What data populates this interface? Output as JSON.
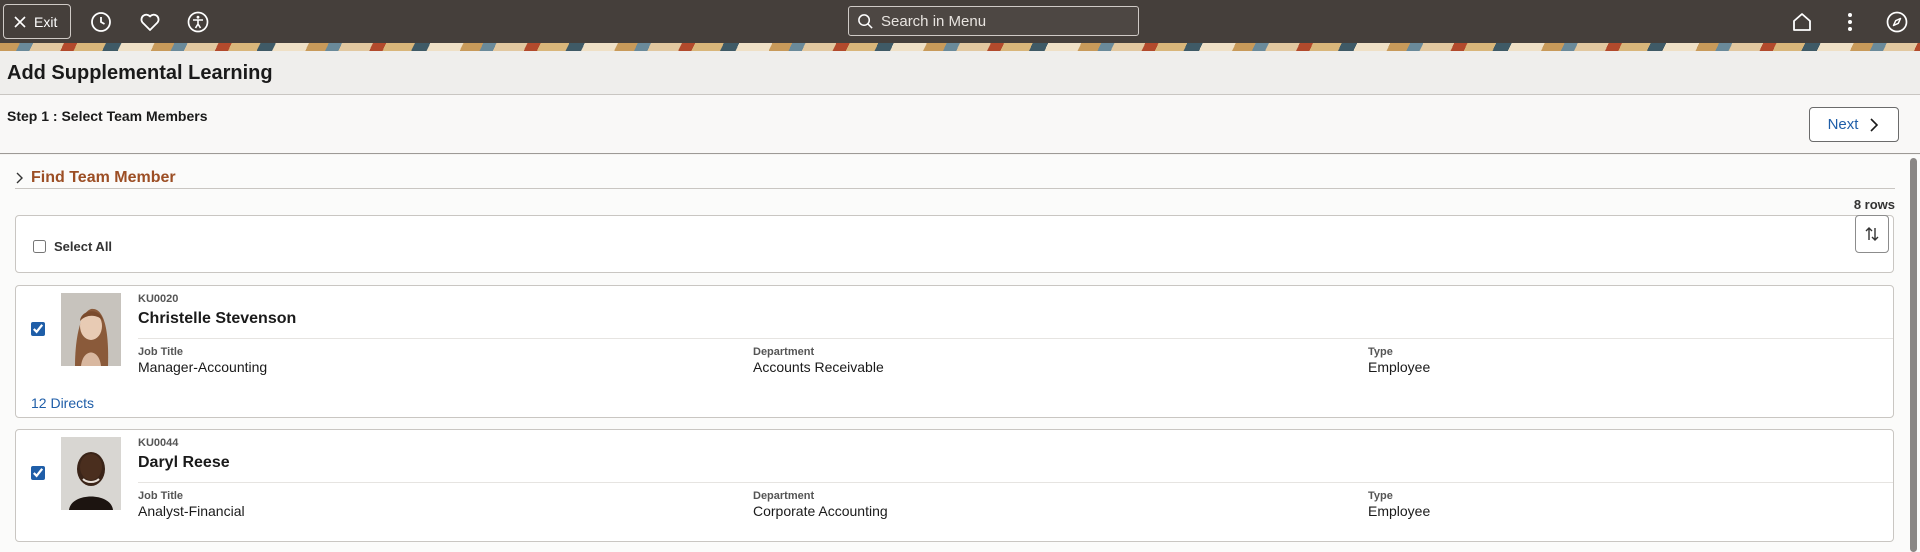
{
  "header": {
    "exit_label": "Exit",
    "search_placeholder": "Search in Menu",
    "icons": [
      "close-icon",
      "history-icon",
      "heart-icon",
      "accessibility-icon",
      "search-icon",
      "home-icon",
      "more-vertical-icon",
      "compass-icon"
    ]
  },
  "page": {
    "title": "Add Supplemental Learning",
    "step_label": "Step 1 : Select Team Members",
    "next_label": "Next"
  },
  "find": {
    "label": "Find Team Member"
  },
  "list": {
    "rows_count": "8 rows",
    "select_all_label": "Select All",
    "select_all_checked": false,
    "employees": [
      {
        "id": "KU0020",
        "name": "Christelle Stevenson",
        "checked": true,
        "job_title_label": "Job Title",
        "job_title": "Manager-Accounting",
        "department_label": "Department",
        "department": "Accounts Receivable",
        "type_label": "Type",
        "type": "Employee",
        "directs": "12 Directs"
      },
      {
        "id": "KU0044",
        "name": "Daryl Reese",
        "checked": true,
        "job_title_label": "Job Title",
        "job_title": "Analyst-Financial",
        "department_label": "Department",
        "department": "Corporate Accounting",
        "type_label": "Type",
        "type": "Employee"
      }
    ]
  },
  "colors": {
    "topbar": "#453f3b",
    "link": "#1f5ea8",
    "section_heading": "#9c4e24"
  }
}
